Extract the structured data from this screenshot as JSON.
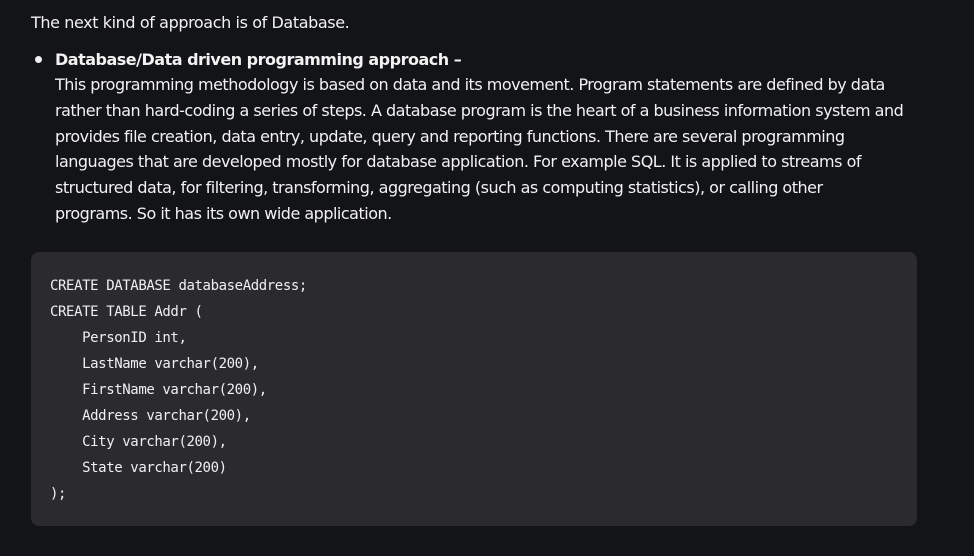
{
  "intro": "The next kind of approach is of Database.",
  "bullet": {
    "heading": "Database/Data driven programming approach –",
    "lines": [
      "This programming methodology is based on data and its movement. Program statements are defined by data",
      "rather than hard-coding a series of steps. A database program is the heart of a business information system and",
      "provides file creation, data entry, update, query and reporting functions. There are several programming",
      "languages that are developed mostly for database application. For example SQL. It is applied to streams of",
      "structured data, for filtering, transforming, aggregating (such as computing statistics), or calling other",
      "programs. So it has its own wide application."
    ]
  },
  "code": {
    "lines": [
      "CREATE DATABASE databaseAddress;",
      "CREATE TABLE Addr (",
      "    PersonID int,",
      "    LastName varchar(200),",
      "    FirstName varchar(200),",
      "    Address varchar(200),",
      "    City varchar(200),",
      "    State varchar(200)",
      ");"
    ]
  },
  "colors": {
    "background": "#131417",
    "code_background": "#2b2b2f",
    "text": "#f2f2f2"
  }
}
